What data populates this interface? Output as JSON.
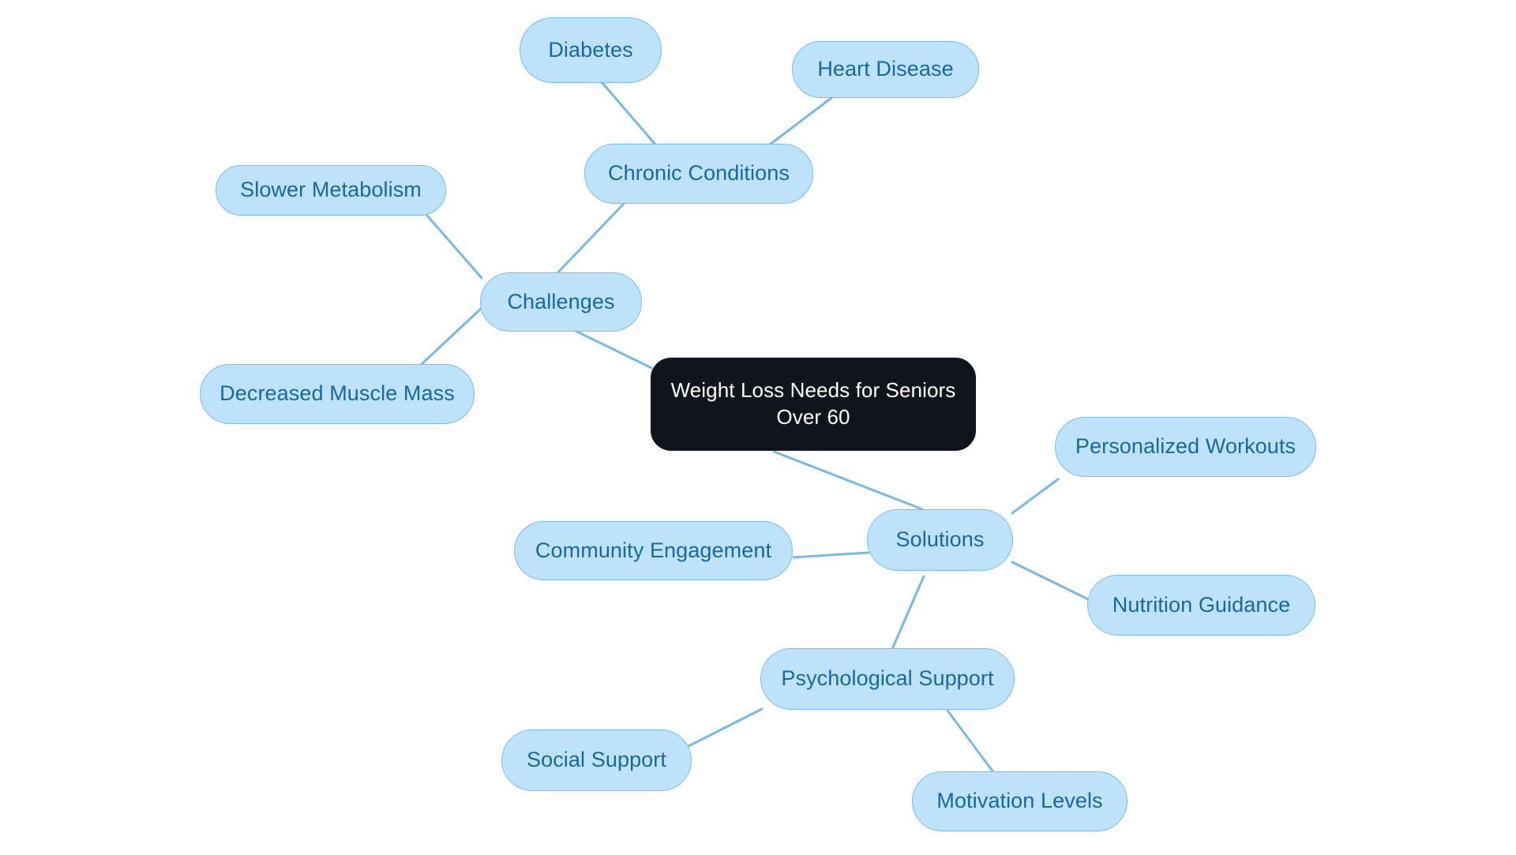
{
  "diagram": {
    "type": "mindmap",
    "title": "Weight Loss Needs for Seniors Over 60",
    "background_color": "#ffffff",
    "edge_color": "#7ab8e0",
    "node_fill": "#bfe2fb",
    "node_border": "#77bdea",
    "node_text_color": "#17679f",
    "root_fill": "#10151d",
    "root_text_color": "#ffffff"
  },
  "nodes": {
    "root": {
      "label": "Weight Loss Needs for Seniors\nOver 60"
    },
    "challenges": {
      "label": "Challenges"
    },
    "chronic_conditions": {
      "label": "Chronic Conditions"
    },
    "diabetes": {
      "label": "Diabetes"
    },
    "heart_disease": {
      "label": "Heart Disease"
    },
    "slower_metabolism": {
      "label": "Slower Metabolism"
    },
    "decreased_muscle_mass": {
      "label": "Decreased Muscle Mass"
    },
    "solutions": {
      "label": "Solutions"
    },
    "personalized_workouts": {
      "label": "Personalized Workouts"
    },
    "nutrition_guidance": {
      "label": "Nutrition Guidance"
    },
    "community_engagement": {
      "label": "Community Engagement"
    },
    "psychological_support": {
      "label": "Psychological Support"
    },
    "social_support": {
      "label": "Social Support"
    },
    "motivation_levels": {
      "label": "Motivation Levels"
    }
  },
  "edges": [
    {
      "from": "root",
      "to": "challenges"
    },
    {
      "from": "challenges",
      "to": "chronic_conditions"
    },
    {
      "from": "chronic_conditions",
      "to": "diabetes"
    },
    {
      "from": "chronic_conditions",
      "to": "heart_disease"
    },
    {
      "from": "challenges",
      "to": "slower_metabolism"
    },
    {
      "from": "challenges",
      "to": "decreased_muscle_mass"
    },
    {
      "from": "root",
      "to": "solutions"
    },
    {
      "from": "solutions",
      "to": "personalized_workouts"
    },
    {
      "from": "solutions",
      "to": "nutrition_guidance"
    },
    {
      "from": "solutions",
      "to": "community_engagement"
    },
    {
      "from": "solutions",
      "to": "psychological_support"
    },
    {
      "from": "psychological_support",
      "to": "social_support"
    },
    {
      "from": "psychological_support",
      "to": "motivation_levels"
    }
  ]
}
